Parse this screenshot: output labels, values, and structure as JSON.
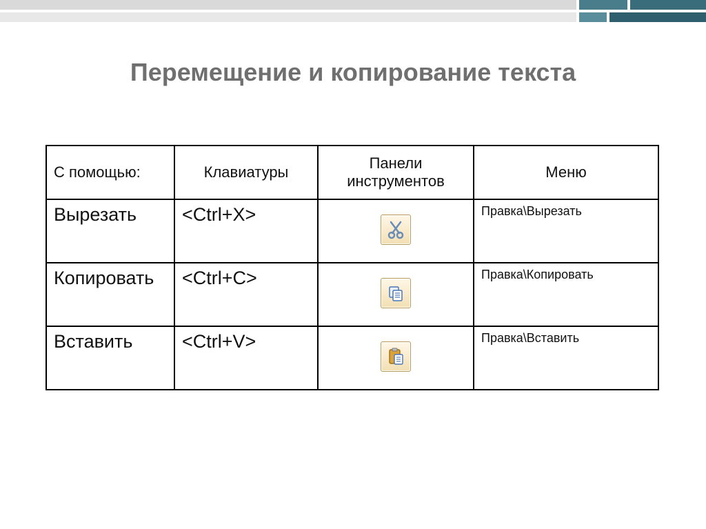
{
  "title": "Перемещение и копирование текста",
  "headers": {
    "c1": "С помощью:",
    "c2": "Клавиатуры",
    "c3": "Панели инструментов",
    "c4": "Меню"
  },
  "rows": [
    {
      "action": "Вырезать",
      "kbd": "<Ctrl+X>",
      "icon": "cut",
      "menu": "Правка\\Вырезать"
    },
    {
      "action": "Копировать",
      "kbd": "<Ctrl+C>",
      "icon": "copy",
      "menu": "Правка\\Копировать"
    },
    {
      "action": "Вставить",
      "kbd": "<Ctrl+V>",
      "icon": "paste",
      "menu": "Правка\\Вставить"
    }
  ]
}
